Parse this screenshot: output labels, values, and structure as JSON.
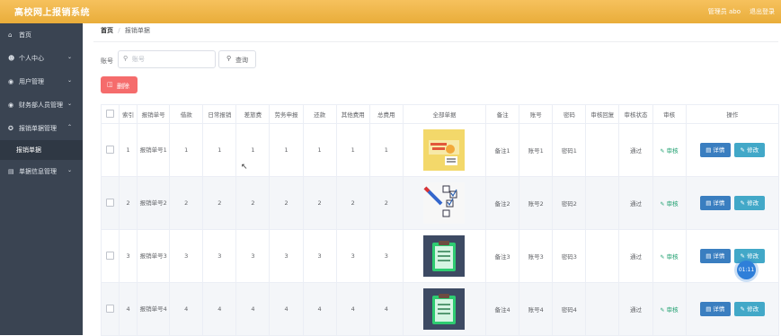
{
  "header": {
    "title": "高校网上报销系统",
    "user": "管理员 abo",
    "logout": "退出登录"
  },
  "sidebar": {
    "items": [
      {
        "icon": "home-icon",
        "label": "首页"
      },
      {
        "icon": "user-icon",
        "label": "个人中心"
      },
      {
        "icon": "user-manage-icon",
        "label": "用户管理"
      },
      {
        "icon": "finance-staff-icon",
        "label": "财务部人员管理"
      },
      {
        "icon": "reimbursement-icon",
        "label": "报销单据管理"
      },
      {
        "icon": "document-icon",
        "label": "单据信息管理"
      }
    ],
    "active_sub": "报销单据"
  },
  "breadcrumb": {
    "home": "首页",
    "separator": "/",
    "current": "报销单据"
  },
  "search": {
    "label": "账号",
    "placeholder": "账号",
    "button": "查询"
  },
  "delete_button": "删除",
  "table": {
    "headers": [
      "索引",
      "报销单号",
      "借款",
      "日常报销",
      "差旅费",
      "劳务申报",
      "还款",
      "其他费用",
      "总费用",
      "全部单据",
      "备注",
      "账号",
      "密码",
      "审核回复",
      "审核状态",
      "审核",
      "操作"
    ],
    "audit_label": "审核",
    "detail_label": "详情",
    "edit_label": "修改",
    "rows": [
      {
        "index": "1",
        "order": "报销单号1",
        "borrow": "1",
        "daily": "1",
        "travel": "1",
        "labor": "1",
        "repay": "1",
        "other": "1",
        "total": "1",
        "image": "image-1",
        "note": "备注1",
        "account": "账号1",
        "password": "密码1",
        "reply": "",
        "status": "通过"
      },
      {
        "index": "2",
        "order": "报销单号2",
        "borrow": "2",
        "daily": "2",
        "travel": "2",
        "labor": "2",
        "repay": "2",
        "other": "2",
        "total": "2",
        "image": "image-2",
        "note": "备注2",
        "account": "账号2",
        "password": "密码2",
        "reply": "",
        "status": "通过"
      },
      {
        "index": "3",
        "order": "报销单号3",
        "borrow": "3",
        "daily": "3",
        "travel": "3",
        "labor": "3",
        "repay": "3",
        "other": "3",
        "total": "3",
        "image": "image-3",
        "note": "备注3",
        "account": "账号3",
        "password": "密码3",
        "reply": "",
        "status": "通过"
      },
      {
        "index": "4",
        "order": "报销单号4",
        "borrow": "4",
        "daily": "4",
        "travel": "4",
        "labor": "4",
        "repay": "4",
        "other": "4",
        "total": "4",
        "image": "image-4",
        "note": "备注4",
        "account": "账号4",
        "password": "密码4",
        "reply": "",
        "status": "通过"
      }
    ]
  },
  "timer": "01:11",
  "colors": {
    "header": "#f0b84b",
    "sidebar": "#3a4452",
    "danger": "#f56c6c",
    "primary": "#3a7ec0",
    "info": "#42a8c8",
    "success": "#20a070"
  }
}
